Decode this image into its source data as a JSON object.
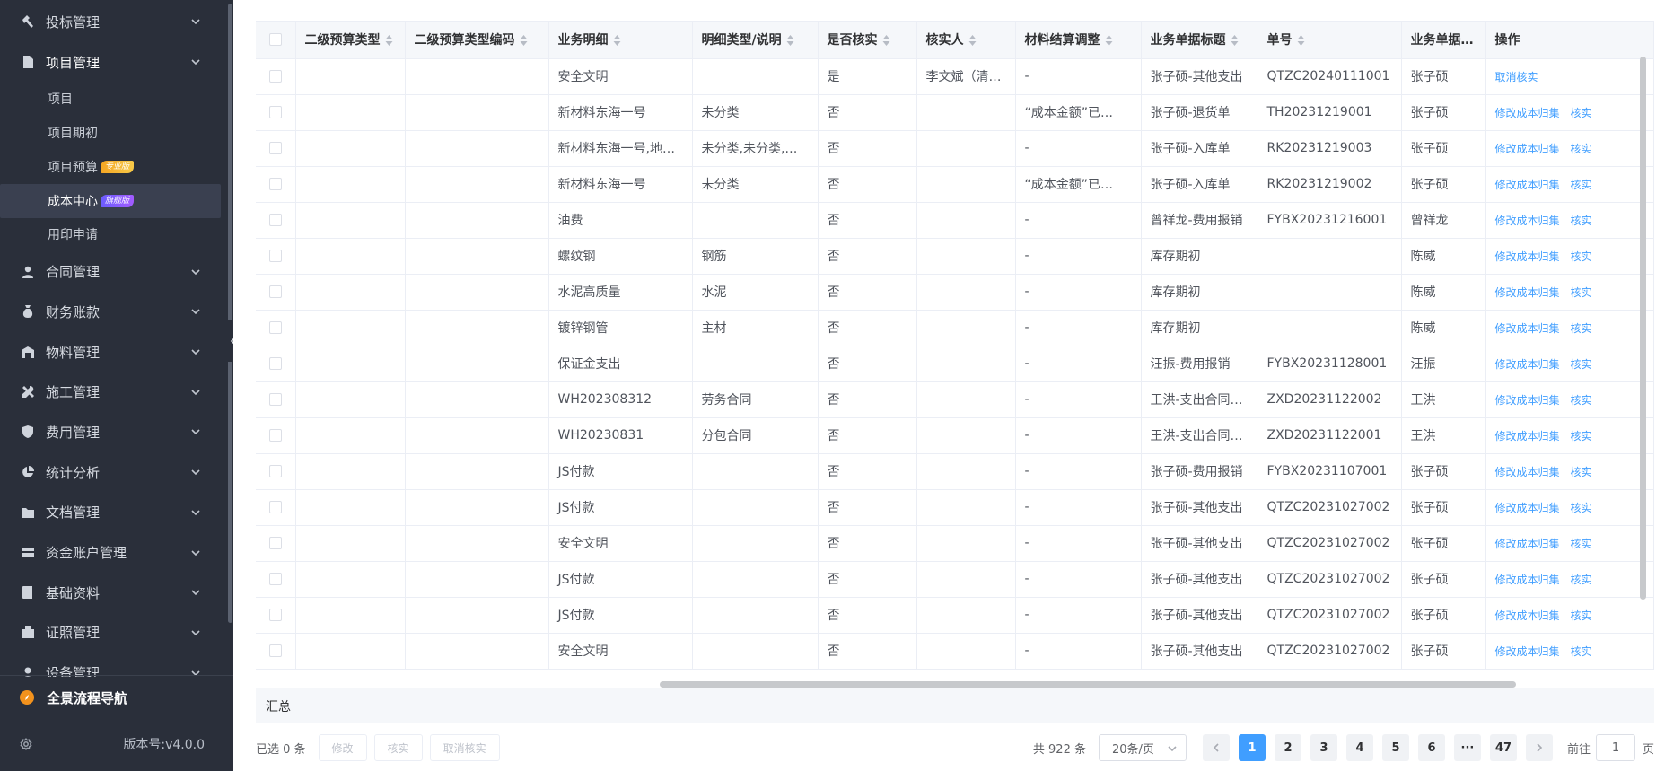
{
  "sidebar": {
    "menu": [
      {
        "label": "投标管理",
        "icon": "hammer-icon",
        "open": false
      },
      {
        "label": "项目管理",
        "icon": "document-icon",
        "open": true,
        "children": [
          {
            "label": "项目",
            "badge": "",
            "active": false
          },
          {
            "label": "项目期初",
            "badge": "",
            "active": false
          },
          {
            "label": "项目预算",
            "badge": "专业版",
            "badge_type": "pro",
            "active": false
          },
          {
            "label": "成本中心",
            "badge": "旗舰版",
            "badge_type": "flag",
            "active": true
          },
          {
            "label": "用印申请",
            "badge": "",
            "active": false
          }
        ]
      },
      {
        "label": "合同管理",
        "icon": "person-icon",
        "open": false
      },
      {
        "label": "财务账款",
        "icon": "money-bag-icon",
        "open": false
      },
      {
        "label": "物料管理",
        "icon": "warehouse-icon",
        "open": false
      },
      {
        "label": "施工管理",
        "icon": "tools-icon",
        "open": false
      },
      {
        "label": "费用管理",
        "icon": "shield-icon",
        "open": false
      },
      {
        "label": "统计分析",
        "icon": "pie-chart-icon",
        "open": false
      },
      {
        "label": "文档管理",
        "icon": "folder-icon",
        "open": false
      },
      {
        "label": "资金账户管理",
        "icon": "card-icon",
        "open": false
      },
      {
        "label": "基础资料",
        "icon": "book-icon",
        "open": false
      },
      {
        "label": "证照管理",
        "icon": "license-icon",
        "open": false
      },
      {
        "label": "设备管理",
        "icon": "device-icon",
        "open": false
      }
    ],
    "nav_flow_label": "全景流程导航",
    "version": "版本号:v4.0.0"
  },
  "table": {
    "columns": [
      {
        "label": "",
        "width": 44
      },
      {
        "label": "二级预算类型",
        "sortable": true,
        "width": 122
      },
      {
        "label": "二级预算类型编码",
        "sortable": true,
        "width": 160
      },
      {
        "label": "业务明细",
        "sortable": true,
        "width": 160
      },
      {
        "label": "明细类型/说明",
        "sortable": true,
        "width": 140
      },
      {
        "label": "是否核实",
        "sortable": true,
        "width": 110
      },
      {
        "label": "核实人",
        "sortable": true,
        "width": 110
      },
      {
        "label": "材料结算调整",
        "sortable": true,
        "width": 140
      },
      {
        "label": "业务单据标题",
        "sortable": true,
        "width": 130
      },
      {
        "label": "单号",
        "sortable": true,
        "width": 160
      },
      {
        "label": "业务单据创建",
        "sortable": false,
        "width": 94
      },
      {
        "label": "操作",
        "sortable": false,
        "width": 187
      }
    ],
    "rows": [
      {
        "detail": "安全文明",
        "type": "",
        "verified": "是",
        "verifier": "李文斌（清…",
        "adjust": "-",
        "title": "张子硕-其他支出",
        "no": "QTZC20240111001",
        "creator": "张子硕",
        "ops": [
          "取消核实"
        ]
      },
      {
        "detail": "新材料东海一号",
        "type": "未分类",
        "verified": "否",
        "verifier": "",
        "adjust": "“成本金额”已…",
        "title": "张子硕-退货单",
        "no": "TH20231219001",
        "creator": "张子硕",
        "ops": [
          "修改成本归集",
          "核实"
        ]
      },
      {
        "detail": "新材料东海一号,地…",
        "type": "未分类,未分类,其…",
        "verified": "否",
        "verifier": "",
        "adjust": "-",
        "title": "张子硕-入库单",
        "no": "RK20231219003",
        "creator": "张子硕",
        "ops": [
          "修改成本归集",
          "核实"
        ]
      },
      {
        "detail": "新材料东海一号",
        "type": "未分类",
        "verified": "否",
        "verifier": "",
        "adjust": "“成本金额”已…",
        "title": "张子硕-入库单",
        "no": "RK20231219002",
        "creator": "张子硕",
        "ops": [
          "修改成本归集",
          "核实"
        ]
      },
      {
        "detail": "油费",
        "type": "",
        "verified": "否",
        "verifier": "",
        "adjust": "-",
        "title": "曾祥龙-费用报销",
        "no": "FYBX20231216001",
        "creator": "曾祥龙",
        "ops": [
          "修改成本归集",
          "核实"
        ]
      },
      {
        "detail": "螺纹钢",
        "type": "钢筋",
        "verified": "否",
        "verifier": "",
        "adjust": "-",
        "title": "库存期初",
        "no": "",
        "creator": "陈威",
        "ops": [
          "修改成本归集",
          "核实"
        ]
      },
      {
        "detail": "水泥高质量",
        "type": "水泥",
        "verified": "否",
        "verifier": "",
        "adjust": "-",
        "title": "库存期初",
        "no": "",
        "creator": "陈威",
        "ops": [
          "修改成本归集",
          "核实"
        ]
      },
      {
        "detail": "镀锌钢管",
        "type": "主材",
        "verified": "否",
        "verifier": "",
        "adjust": "-",
        "title": "库存期初",
        "no": "",
        "creator": "陈威",
        "ops": [
          "修改成本归集",
          "核实"
        ]
      },
      {
        "detail": "保证金支出",
        "type": "",
        "verified": "否",
        "verifier": "",
        "adjust": "-",
        "title": "汪振-费用报销",
        "no": "FYBX20231128001",
        "creator": "汪振",
        "ops": [
          "修改成本归集",
          "核实"
        ]
      },
      {
        "detail": "WH202308312",
        "type": "劳务合同",
        "verified": "否",
        "verifier": "",
        "adjust": "-",
        "title": "王洪-支出合同…",
        "no": "ZXD20231122002",
        "creator": "王洪",
        "ops": [
          "修改成本归集",
          "核实"
        ]
      },
      {
        "detail": "WH20230831",
        "type": "分包合同",
        "verified": "否",
        "verifier": "",
        "adjust": "-",
        "title": "王洪-支出合同…",
        "no": "ZXD20231122001",
        "creator": "王洪",
        "ops": [
          "修改成本归集",
          "核实"
        ]
      },
      {
        "detail": "JS付款",
        "type": "",
        "verified": "否",
        "verifier": "",
        "adjust": "-",
        "title": "张子硕-费用报销",
        "no": "FYBX20231107001",
        "creator": "张子硕",
        "ops": [
          "修改成本归集",
          "核实"
        ]
      },
      {
        "detail": "JS付款",
        "type": "",
        "verified": "否",
        "verifier": "",
        "adjust": "-",
        "title": "张子硕-其他支出",
        "no": "QTZC20231027002",
        "creator": "张子硕",
        "ops": [
          "修改成本归集",
          "核实"
        ]
      },
      {
        "detail": "安全文明",
        "type": "",
        "verified": "否",
        "verifier": "",
        "adjust": "-",
        "title": "张子硕-其他支出",
        "no": "QTZC20231027002",
        "creator": "张子硕",
        "ops": [
          "修改成本归集",
          "核实"
        ]
      },
      {
        "detail": "JS付款",
        "type": "",
        "verified": "否",
        "verifier": "",
        "adjust": "-",
        "title": "张子硕-其他支出",
        "no": "QTZC20231027002",
        "creator": "张子硕",
        "ops": [
          "修改成本归集",
          "核实"
        ]
      },
      {
        "detail": "JS付款",
        "type": "",
        "verified": "否",
        "verifier": "",
        "adjust": "-",
        "title": "张子硕-其他支出",
        "no": "QTZC20231027002",
        "creator": "张子硕",
        "ops": [
          "修改成本归集",
          "核实"
        ]
      },
      {
        "detail": "安全文明",
        "type": "",
        "verified": "否",
        "verifier": "",
        "adjust": "-",
        "title": "张子硕-其他支出",
        "no": "QTZC20231027002",
        "creator": "张子硕",
        "ops": [
          "修改成本归集",
          "核实"
        ]
      }
    ],
    "summary_label": "汇总"
  },
  "footer": {
    "selected_text": "已选 0 条",
    "actions": [
      "修改",
      "核实",
      "取消核实"
    ],
    "total_text": "共 922 条",
    "page_size": "20条/页",
    "pages": [
      "1",
      "2",
      "3",
      "4",
      "5",
      "6",
      "···",
      "47"
    ],
    "current_page": "1",
    "goto_label": "前往",
    "goto_value": "1",
    "goto_unit": "页"
  },
  "colors": {
    "sidebar_bg": "#2a2f3a",
    "accent": "#409eff",
    "header_bg": "#f5f7fa"
  }
}
